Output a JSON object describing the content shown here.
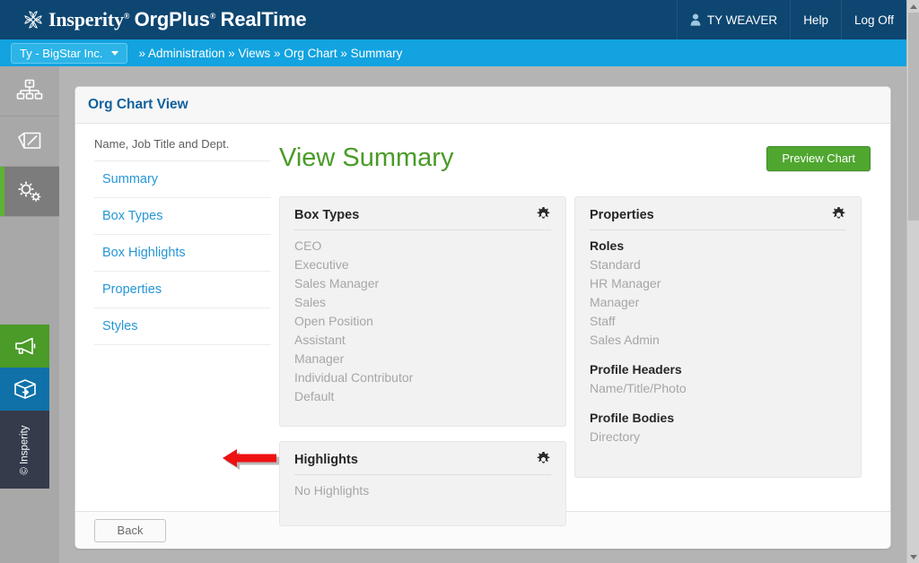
{
  "header": {
    "brand_primary": "Insperity",
    "brand_secondary": "OrgPlus",
    "brand_tertiary": "RealTime",
    "user_name": "TY WEAVER",
    "help_label": "Help",
    "logoff_label": "Log Off",
    "bg_color": "#0d4671"
  },
  "breadcrumb": {
    "org_selector": "Ty - BigStar Inc.",
    "path": "» Administration » Views » Org Chart » Summary",
    "bg_color": "#12a3e0"
  },
  "rail": {
    "items": [
      {
        "name": "org-chart-icon",
        "label": "Org Chart",
        "active": false
      },
      {
        "name": "edit-icon",
        "label": "Edit",
        "active": false
      },
      {
        "name": "gears-icon",
        "label": "Administration",
        "active": true
      }
    ],
    "bottom": [
      {
        "name": "megaphone-icon",
        "label": "Announcements",
        "color": "#4a9b28"
      },
      {
        "name": "package-icon",
        "label": "What's New",
        "color": "#0f71a8"
      }
    ],
    "copyright": "© Insperity"
  },
  "card": {
    "title": "Org Chart View",
    "back_label": "Back"
  },
  "sidenav": {
    "caption": "Name, Job Title and Dept.",
    "items": [
      {
        "label": "Summary"
      },
      {
        "label": "Box Types"
      },
      {
        "label": "Box Highlights"
      },
      {
        "label": "Properties"
      },
      {
        "label": "Styles"
      }
    ]
  },
  "main": {
    "page_title": "View Summary",
    "preview_button": "Preview Chart",
    "accent_green": "#4a9b28"
  },
  "panels": {
    "box_types": {
      "title": "Box Types",
      "items": [
        "CEO",
        "Executive",
        "Sales Manager",
        "Sales",
        "Open Position",
        "Assistant",
        "Manager",
        "Individual Contributor",
        "Default"
      ]
    },
    "highlights": {
      "title": "Highlights",
      "items": [
        "No Highlights"
      ]
    },
    "properties": {
      "title": "Properties",
      "groups": [
        {
          "label": "Roles",
          "items": [
            "Standard",
            "HR Manager",
            "Manager",
            "Staff",
            "Sales Admin"
          ]
        },
        {
          "label": "Profile Headers",
          "items": [
            "Name/Title/Photo"
          ]
        },
        {
          "label": "Profile Bodies",
          "items": [
            "Directory"
          ]
        }
      ]
    }
  },
  "annotation": {
    "arrow_color": "#ee1111",
    "points_to": "Styles"
  }
}
